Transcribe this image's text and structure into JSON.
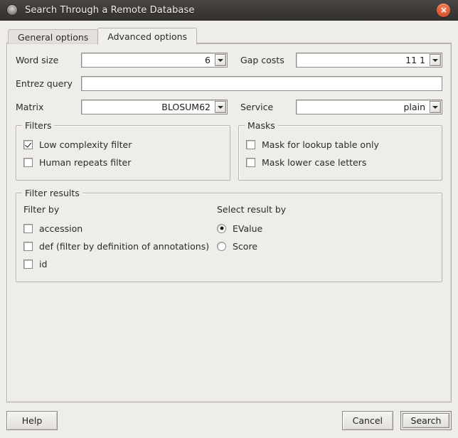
{
  "window": {
    "title": "Search Through a Remote Database",
    "icon": "app-dot-icon",
    "close_icon": "close-icon"
  },
  "tabs": [
    {
      "label": "General options",
      "active": false
    },
    {
      "label": "Advanced options",
      "active": true
    }
  ],
  "fields": {
    "word_size": {
      "label": "Word size",
      "value": "6"
    },
    "gap_costs": {
      "label": "Gap costs",
      "value": "11 1"
    },
    "entrez_query": {
      "label": "Entrez query",
      "value": "",
      "placeholder": ""
    },
    "matrix": {
      "label": "Matrix",
      "value": "BLOSUM62"
    },
    "service": {
      "label": "Service",
      "value": "plain"
    }
  },
  "filters_group": {
    "title": "Filters",
    "items": [
      {
        "label": "Low complexity filter",
        "checked": true
      },
      {
        "label": "Human repeats filter",
        "checked": false
      }
    ]
  },
  "masks_group": {
    "title": "Masks",
    "items": [
      {
        "label": "Mask for lookup table only",
        "checked": false
      },
      {
        "label": "Mask lower case letters",
        "checked": false
      }
    ]
  },
  "filter_results_group": {
    "title": "Filter results",
    "filter_by": {
      "heading": "Filter by",
      "items": [
        {
          "label": "accession",
          "checked": false
        },
        {
          "label": "def (filter by definition of annotations)",
          "checked": false
        },
        {
          "label": "id",
          "checked": false
        }
      ]
    },
    "select_result_by": {
      "heading": "Select result by",
      "options": [
        {
          "label": "EValue",
          "selected": true
        },
        {
          "label": "Score",
          "selected": false
        }
      ]
    }
  },
  "footer": {
    "help_label": "Help",
    "cancel_label": "Cancel",
    "search_label": "Search"
  },
  "colors": {
    "titlebar": "#3c3936",
    "close_button": "#e4613a",
    "dialog_background": "#efedea",
    "field_background": "#ffffff",
    "border": "#b5b2ad"
  }
}
